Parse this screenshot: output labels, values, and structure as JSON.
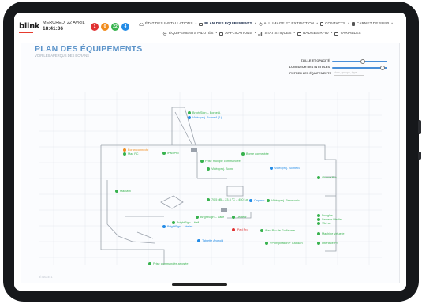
{
  "header": {
    "logo": "blink",
    "date": "MERCREDI 22 AVRIL",
    "time": "18:41:36",
    "badges": [
      {
        "value": "1",
        "color": "#e03131"
      },
      {
        "value": "0",
        "color": "#f08c1e"
      },
      {
        "value": "22",
        "color": "#37b24d"
      },
      {
        "value": "4",
        "color": "#228be6"
      }
    ]
  },
  "nav_row1": [
    {
      "label": "ÉTAT DES INSTALLATIONS",
      "icon": "cloud-icon"
    },
    {
      "label": "PLAN DES ÉQUIPEMENTS",
      "icon": "map-icon",
      "active": true
    },
    {
      "label": "ALLUMAGE ET EXTINCTION",
      "icon": "power-icon"
    },
    {
      "label": "CONTACTS",
      "icon": "contact-icon"
    },
    {
      "label": "CARNET DE SUIVI",
      "icon": "book-icon"
    }
  ],
  "nav_row2": [
    {
      "label": "ÉQUIPEMENTS PILOTÉS",
      "icon": "devices-icon"
    },
    {
      "label": "APPLICATIONS",
      "icon": "apps-icon"
    },
    {
      "label": "STATISTIQUES",
      "icon": "chart-icon"
    },
    {
      "label": "BADGES RFID",
      "icon": "badge-icon"
    },
    {
      "label": "VARIABLES",
      "icon": "variables-icon"
    }
  ],
  "page": {
    "title": "PLAN DES ÉQUIPEMENTS",
    "subtitle": "VOIR LES APERÇUS DES ÉCRANS",
    "floor": "ÉTAGE 1"
  },
  "controls": {
    "size_opacity_label": "TAILLE ET OPACITÉ",
    "size_opacity_value": 0.55,
    "label_length_label": "LONGUEUR DES INTITULÉS",
    "label_length_value": 0.92,
    "filter_label": "FILTRER LES ÉQUIPEMENTS",
    "filter_placeholder": "Nom, groupe, type..."
  },
  "colors": {
    "ok": "#37b24d",
    "info": "#228be6",
    "warning": "#f08c1e",
    "error": "#e03131",
    "accent": "#5b93c9"
  },
  "devices": [
    {
      "label": "BrightSign – Borne A",
      "status": "ok"
    },
    {
      "label": "Vidéoproj. Borne A (1)",
      "status": "info"
    },
    {
      "label": "Écran connecté",
      "status": "warning"
    },
    {
      "label": "Mac PC",
      "status": "ok"
    },
    {
      "label": "iPad Pro",
      "status": "ok"
    },
    {
      "label": "Prise multiple commandée",
      "status": "ok"
    },
    {
      "label": "Borne connectée",
      "status": "ok"
    },
    {
      "label": "Vidéoproj. Borne",
      "status": "ok"
    },
    {
      "label": "Vidéoproj. Borne B",
      "status": "info"
    },
    {
      "label": "iPhone Pro",
      "status": "ok"
    },
    {
      "label": "MacMini",
      "status": "ok"
    },
    {
      "label": "70.5 dB – 23.3 °C – 450 lux",
      "status": "ok"
    },
    {
      "label": "Capteur",
      "status": "info"
    },
    {
      "label": "Vidéoproj. Panasonic",
      "status": "ok"
    },
    {
      "label": "Douglas",
      "status": "ok"
    },
    {
      "label": "Serveur Media",
      "status": "ok"
    },
    {
      "label": "Vitrine",
      "status": "ok"
    },
    {
      "label": "BrightSign – Salle",
      "status": "ok"
    },
    {
      "label": "Lecteur",
      "status": "ok"
    },
    {
      "label": "BrightSign – Hall",
      "status": "ok"
    },
    {
      "label": "BrightSign – Atelier",
      "status": "info"
    },
    {
      "label": "iPad Pro",
      "status": "error"
    },
    {
      "label": "iPad Pro de Guillaume",
      "status": "ok"
    },
    {
      "label": "Machine virtuelle",
      "status": "ok"
    },
    {
      "label": "Tablette Android",
      "status": "info"
    },
    {
      "label": "VP Inspiration + Caisson",
      "status": "ok"
    },
    {
      "label": "Interface PS",
      "status": "ok"
    },
    {
      "label": "Prise commandée arrosée",
      "status": "ok"
    }
  ]
}
